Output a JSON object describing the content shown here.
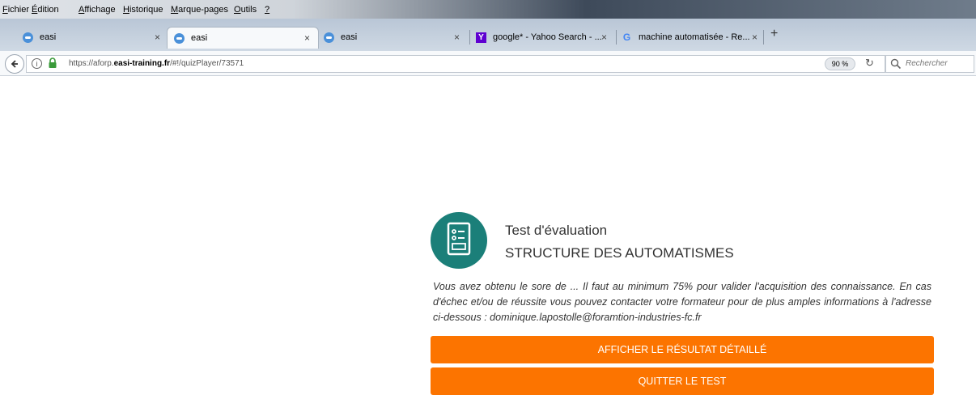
{
  "menu": {
    "items": [
      {
        "first": "F",
        "rest": "ichier"
      },
      {
        "first": "É",
        "rest": "dition"
      },
      {
        "first": "A",
        "rest": "ffichage"
      },
      {
        "first": "H",
        "rest": "istorique"
      },
      {
        "first": "M",
        "rest": "arque-pages"
      },
      {
        "first": "O",
        "rest": "utils"
      },
      {
        "first": "?",
        "rest": ""
      }
    ]
  },
  "tabs": [
    {
      "label": "easi",
      "favicon": "easi-icon"
    },
    {
      "label": "easi",
      "favicon": "easi-icon",
      "active": true
    },
    {
      "label": "easi",
      "favicon": "easi-icon"
    },
    {
      "label": "google* - Yahoo Search - ...",
      "favicon": "yahoo-icon"
    },
    {
      "label": "machine automatisée - Re...",
      "favicon": "google-icon"
    }
  ],
  "tab_close": "×",
  "new_tab": "+",
  "nav": {
    "url_prefix": "https://aforp.",
    "url_domain": "easi-training.fr",
    "url_suffix": "/#!/quizPlayer/73571",
    "zoom": "90 %",
    "search_placeholder": "Rechercher"
  },
  "quiz": {
    "title": "Test d'évaluation",
    "subtitle": "STRUCTURE DES AUTOMATISMES",
    "message": "Vous avez obtenu le sore de ... Il faut au minimum 75% pour valider l'acquisition des connaissance. En cas d'échec et/ou de réussite vous pouvez contacter votre formateur pour de plus amples informations à l'adresse ci-dessous : dominique.lapostolle@foramtion-industries-fc.fr",
    "detail_button": "AFFICHER LE RÉSULTAT DÉTAILLÉ",
    "quit_button": "QUITTER LE TEST"
  },
  "colors": {
    "accent": "#fc7400",
    "icon_bg": "#1b7f79"
  }
}
